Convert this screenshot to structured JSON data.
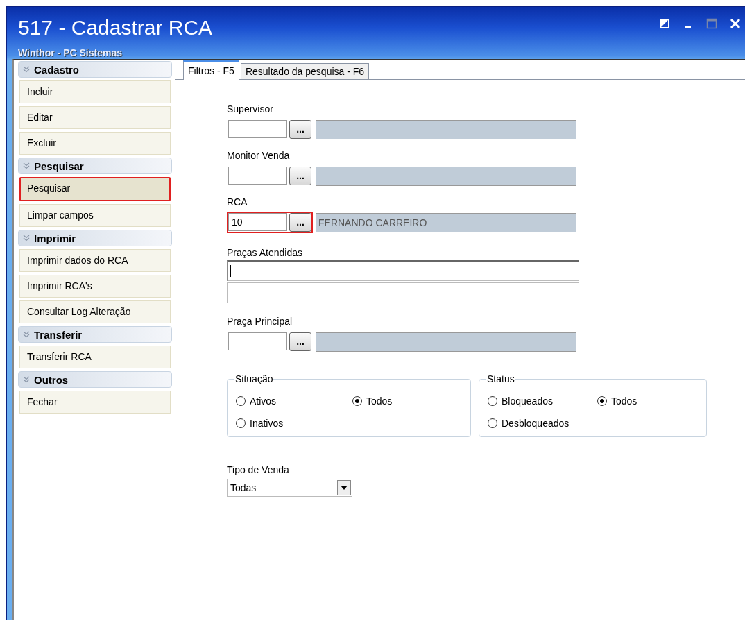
{
  "window": {
    "title": "517 - Cadastrar RCA",
    "subtitle": "Winthor - PC Sistemas"
  },
  "sidebar": {
    "groups": [
      {
        "title": "Cadastro",
        "items": [
          {
            "label": "Incluir",
            "highlighted": false
          },
          {
            "label": "Editar",
            "highlighted": false
          },
          {
            "label": "Excluir",
            "highlighted": false
          }
        ]
      },
      {
        "title": "Pesquisar",
        "items": [
          {
            "label": "Pesquisar",
            "highlighted": true
          },
          {
            "label": "Limpar campos",
            "highlighted": false
          }
        ]
      },
      {
        "title": "Imprimir",
        "items": [
          {
            "label": "Imprimir dados do RCA",
            "highlighted": false
          },
          {
            "label": "Imprimir RCA's",
            "highlighted": false
          },
          {
            "label": "Consultar Log Alteração",
            "highlighted": false
          }
        ]
      },
      {
        "title": "Transferir",
        "items": [
          {
            "label": "Transferir RCA",
            "highlighted": false
          }
        ]
      },
      {
        "title": "Outros",
        "items": [
          {
            "label": "Fechar",
            "highlighted": false
          }
        ]
      }
    ]
  },
  "tabs": [
    {
      "label": "Filtros - F5",
      "selected": true
    },
    {
      "label": "Resultado da pesquisa - F6",
      "selected": false
    }
  ],
  "fields": [
    {
      "kind": "lookup",
      "label": "Supervisor",
      "button": "...",
      "highlighted": false
    },
    {
      "kind": "lookup",
      "label": "Monitor Venda",
      "button": "...",
      "highlighted": false
    },
    {
      "kind": "lookup",
      "label": "RCA",
      "code": "10",
      "button": "...",
      "description": "FERNANDO CARREIRO",
      "highlighted": true
    },
    {
      "kind": "multi",
      "label": "Praças Atendidas",
      "focused": true
    },
    {
      "kind": "lookup",
      "label": "Praça Principal",
      "button": "...",
      "highlighted": false
    }
  ],
  "radio_groups": [
    {
      "title": "Situação",
      "options": [
        {
          "label": "Ativos",
          "selected": false
        },
        {
          "label": "Todos",
          "selected": true
        },
        {
          "label": "Inativos",
          "selected": false
        }
      ]
    },
    {
      "title": "Status",
      "options": [
        {
          "label": "Bloqueados",
          "selected": false
        },
        {
          "label": "Todos",
          "selected": true
        },
        {
          "label": "Desbloqueados",
          "selected": false
        }
      ]
    }
  ],
  "tipo_de_venda": {
    "label": "Tipo de Venda",
    "value": "Todas"
  }
}
